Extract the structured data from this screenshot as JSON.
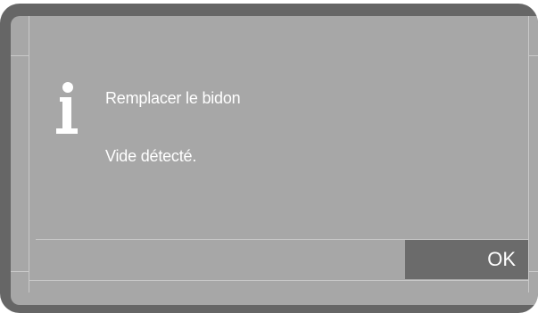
{
  "dialog": {
    "icon": "info-icon",
    "title": "Remplacer le bidon",
    "detail": "Vide détecté.",
    "ok_label": "OK"
  },
  "colors": {
    "frame": "#666666",
    "screen": "#a7a7a7",
    "button": "#6b6b6b",
    "text": "#ffffff"
  }
}
